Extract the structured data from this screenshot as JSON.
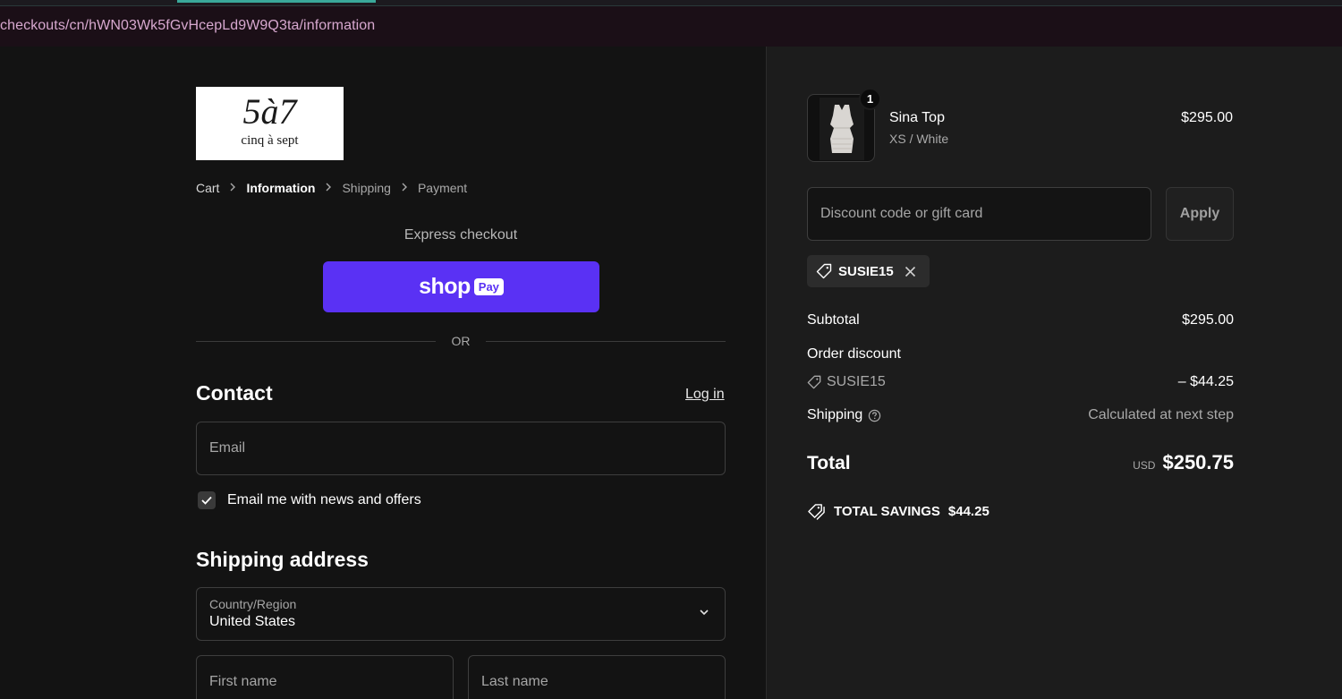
{
  "browser": {
    "url": "checkouts/cn/hWN03Wk5fGvHcepLd9W9Q3ta/information"
  },
  "logo": {
    "mark": "5à7",
    "wordmark": "cinq à sept"
  },
  "breadcrumb": {
    "items": [
      "Cart",
      "Information",
      "Shipping",
      "Payment"
    ],
    "active": "Information"
  },
  "express": {
    "label": "Express checkout",
    "shop_pay": {
      "shop": "shop",
      "pay": "Pay"
    },
    "divider": "OR"
  },
  "contact": {
    "heading": "Contact",
    "login": "Log in",
    "email_placeholder": "Email",
    "newsletter_label": "Email me with news and offers",
    "newsletter_checked": true
  },
  "shipping_address": {
    "heading": "Shipping address",
    "country_label": "Country/Region",
    "country_value": "United States",
    "first_name_placeholder": "First name",
    "last_name_placeholder": "Last name"
  },
  "summary": {
    "product": {
      "name": "Sina Top",
      "variant": "XS / White",
      "price": "$295.00",
      "quantity": "1"
    },
    "discount": {
      "placeholder": "Discount code or gift card",
      "apply": "Apply",
      "applied_code": "SUSIE15"
    },
    "subtotal_label": "Subtotal",
    "subtotal": "$295.00",
    "order_discount_label": "Order discount",
    "discount_code": "SUSIE15",
    "discount_amount": "– $44.25",
    "shipping_label": "Shipping",
    "shipping_value": "Calculated at next step",
    "total_label": "Total",
    "currency": "USD",
    "total": "$250.75",
    "savings_label": "TOTAL SAVINGS",
    "savings_amount": "$44.25"
  },
  "colors": {
    "shop_pay": "#5a31f4",
    "page_bg": "#131313",
    "summary_bg": "#1c1c1c"
  }
}
